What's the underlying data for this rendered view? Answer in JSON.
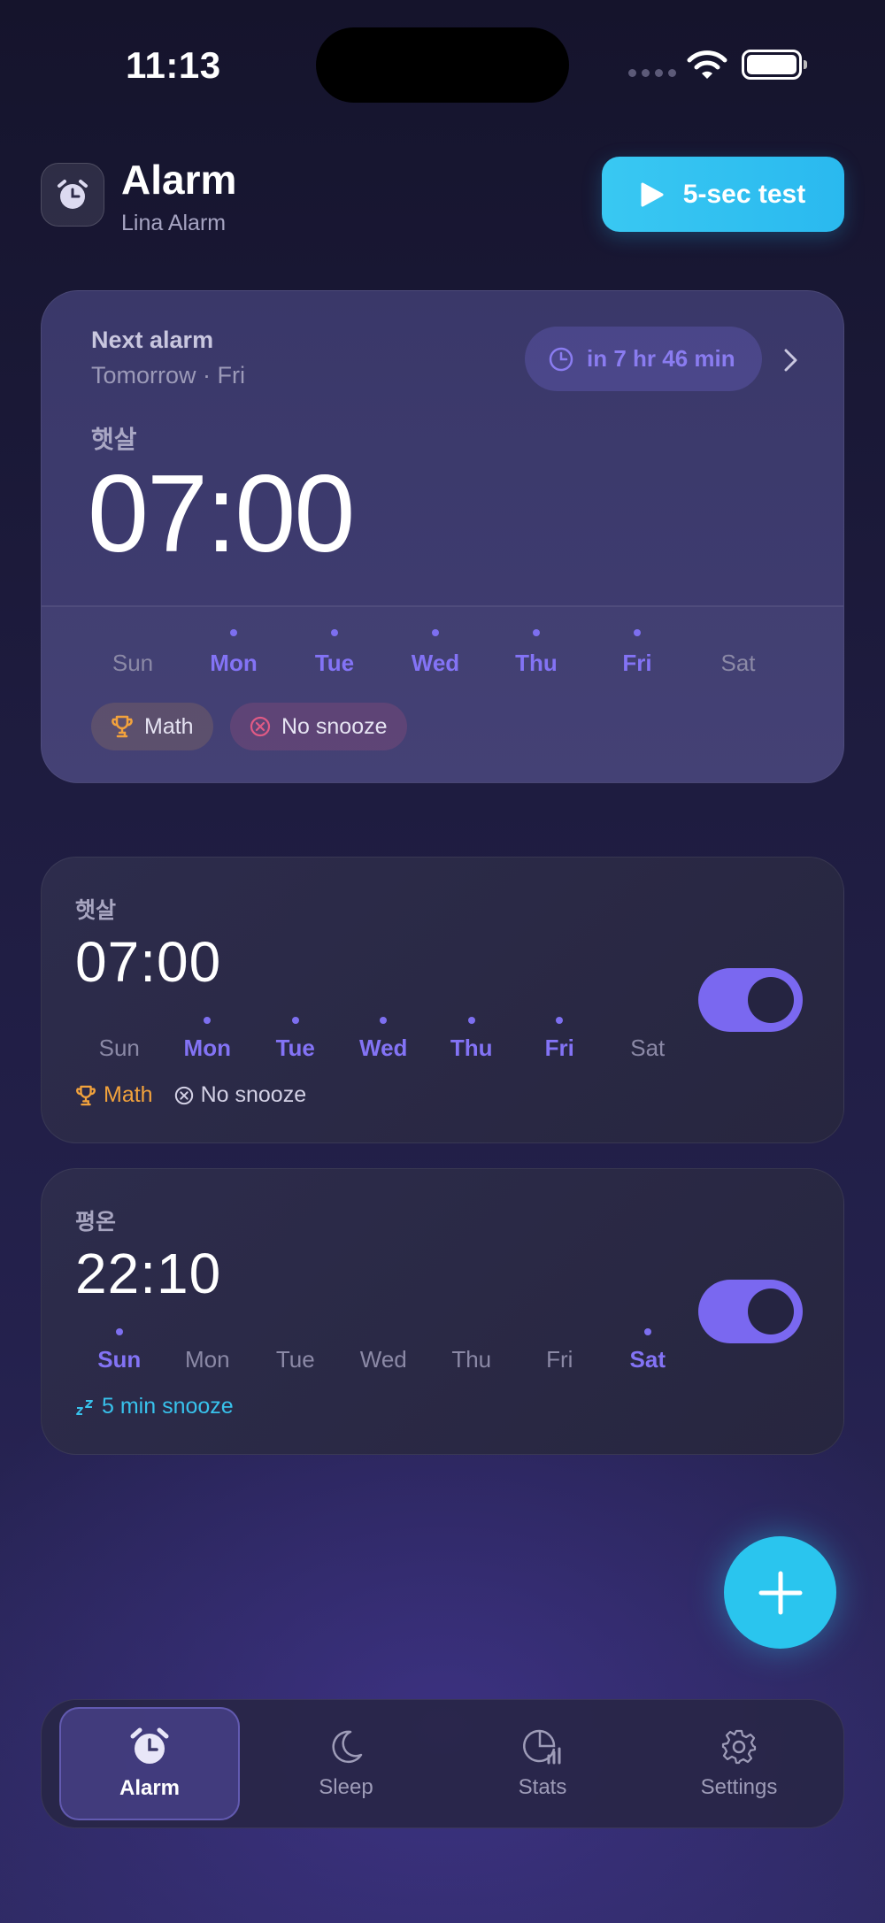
{
  "status_bar": {
    "time": "11:13"
  },
  "header": {
    "title": "Alarm",
    "subtitle": "Lina Alarm",
    "test_button": "5-sec test"
  },
  "next_alarm": {
    "label": "Next alarm",
    "day": "Tomorrow · Fri",
    "countdown": "in 7 hr 46 min",
    "name": "햇살",
    "time": "07:00",
    "days": [
      {
        "label": "Sun",
        "on": false
      },
      {
        "label": "Mon",
        "on": true
      },
      {
        "label": "Tue",
        "on": true
      },
      {
        "label": "Wed",
        "on": true
      },
      {
        "label": "Thu",
        "on": true
      },
      {
        "label": "Fri",
        "on": true
      },
      {
        "label": "Sat",
        "on": false
      }
    ],
    "chips": {
      "math": "Math",
      "no_snooze": "No snooze"
    }
  },
  "alarms": [
    {
      "name": "햇살",
      "time": "07:00",
      "enabled": true,
      "days": [
        {
          "label": "Sun",
          "on": false
        },
        {
          "label": "Mon",
          "on": true
        },
        {
          "label": "Tue",
          "on": true
        },
        {
          "label": "Wed",
          "on": true
        },
        {
          "label": "Thu",
          "on": true
        },
        {
          "label": "Fri",
          "on": true
        },
        {
          "label": "Sat",
          "on": false
        }
      ],
      "tags": {
        "math": "Math",
        "no_snooze": "No snooze"
      }
    },
    {
      "name": "평온",
      "time": "22:10",
      "enabled": true,
      "days": [
        {
          "label": "Sun",
          "on": true
        },
        {
          "label": "Mon",
          "on": false
        },
        {
          "label": "Tue",
          "on": false
        },
        {
          "label": "Wed",
          "on": false
        },
        {
          "label": "Thu",
          "on": false
        },
        {
          "label": "Fri",
          "on": false
        },
        {
          "label": "Sat",
          "on": true
        }
      ],
      "tags": {
        "snooze": "5 min snooze"
      }
    }
  ],
  "tabs": [
    {
      "label": "Alarm",
      "icon": "alarm-clock-icon",
      "active": true
    },
    {
      "label": "Sleep",
      "icon": "moon-icon",
      "active": false
    },
    {
      "label": "Stats",
      "icon": "chart-icon",
      "active": false
    },
    {
      "label": "Settings",
      "icon": "gear-icon",
      "active": false
    }
  ],
  "colors": {
    "accent": "#7a68f0",
    "cyan": "#2ac5ee",
    "math": "#f2a23c",
    "background": "#1d1b3d"
  }
}
